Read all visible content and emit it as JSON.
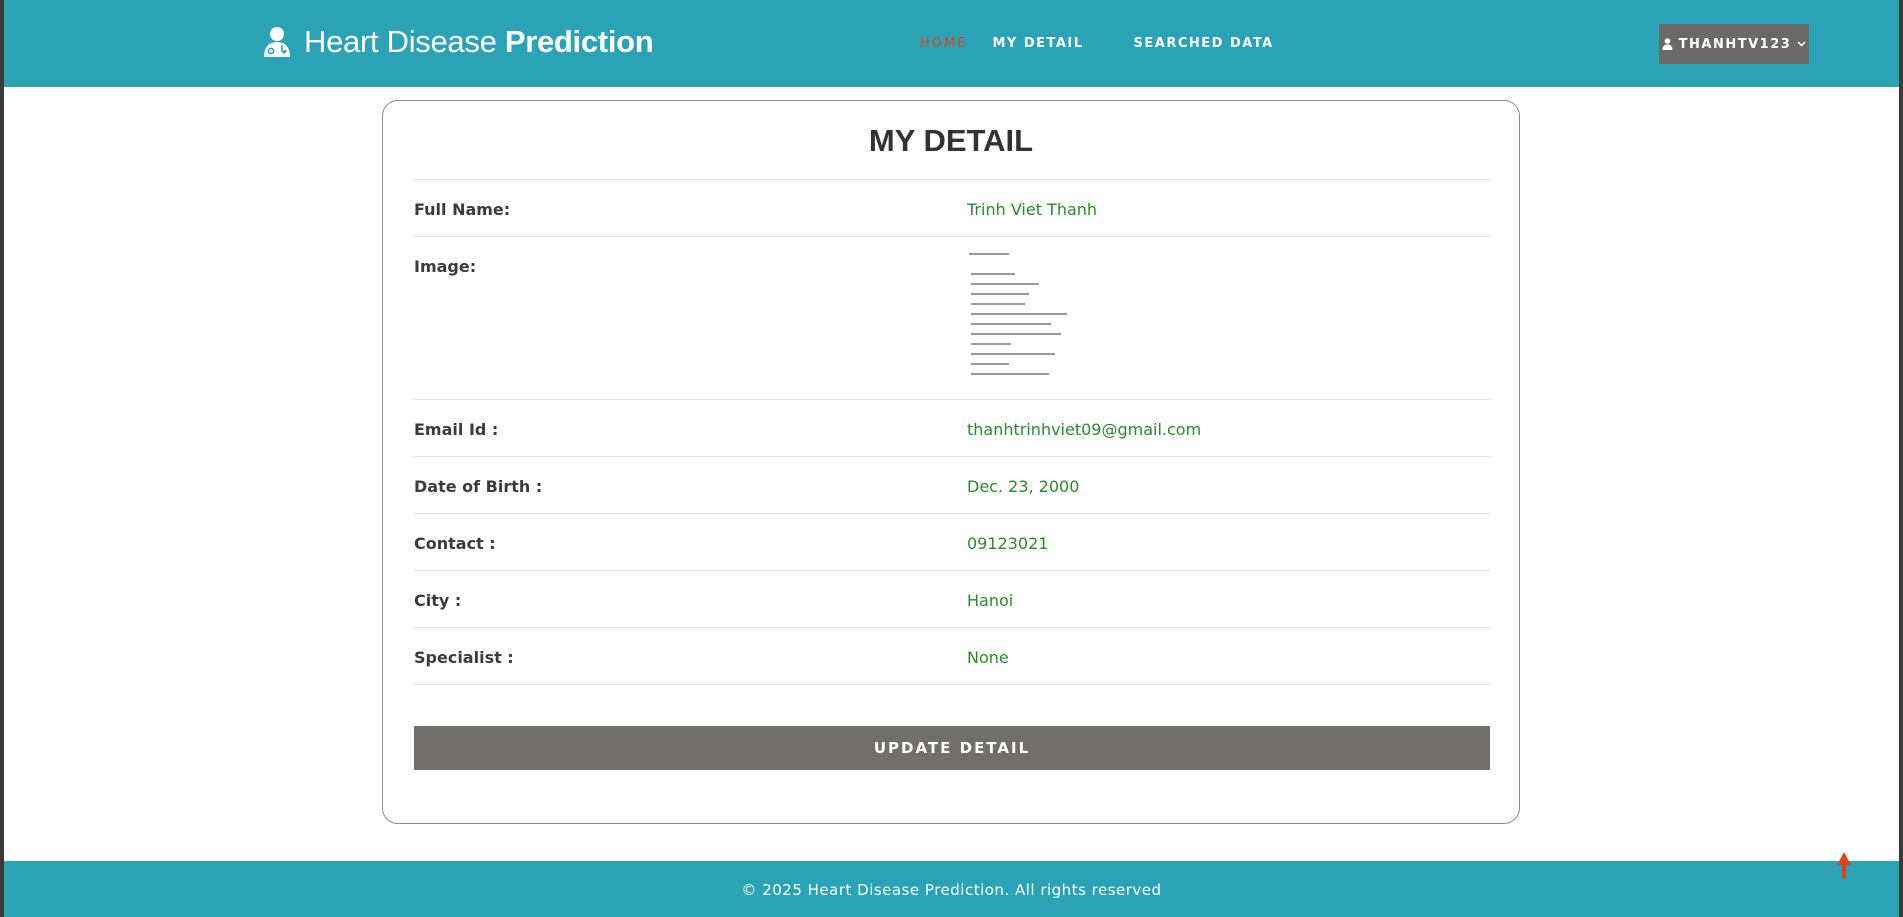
{
  "header": {
    "brand_light": "Heart Disease ",
    "brand_bold": "Prediction",
    "nav": {
      "home": "HOME",
      "my_detail": "MY DETAIL",
      "searched_data": "SEARCHED DATA"
    },
    "user_menu_label": "THANHTV123",
    "icons": {
      "brand": "doctor-icon",
      "user": "user-icon",
      "dropdown": "chevron-down-icon"
    }
  },
  "detail": {
    "title": "MY DETAIL",
    "rows": [
      {
        "label": "Full Name:",
        "value": "Trinh Viet Thanh"
      },
      {
        "label": "Image:",
        "value": ""
      },
      {
        "label": "Email Id :",
        "value": "thanhtrinhviet09@gmail.com"
      },
      {
        "label": "Date of Birth :",
        "value": "Dec. 23, 2000"
      },
      {
        "label": "Contact :",
        "value": "09123021"
      },
      {
        "label": "City :",
        "value": "Hanoi"
      },
      {
        "label": "Specialist :",
        "value": "None"
      }
    ],
    "update_button": "UPDATE DETAIL"
  },
  "footer": {
    "text": "© 2025 Heart Disease Prediction. All rights reserved"
  },
  "colors": {
    "header_bg": "#2aa3b6",
    "active_nav": "#e0401a",
    "value_text": "#2a8a2a",
    "button_bg": "#736e6e"
  }
}
